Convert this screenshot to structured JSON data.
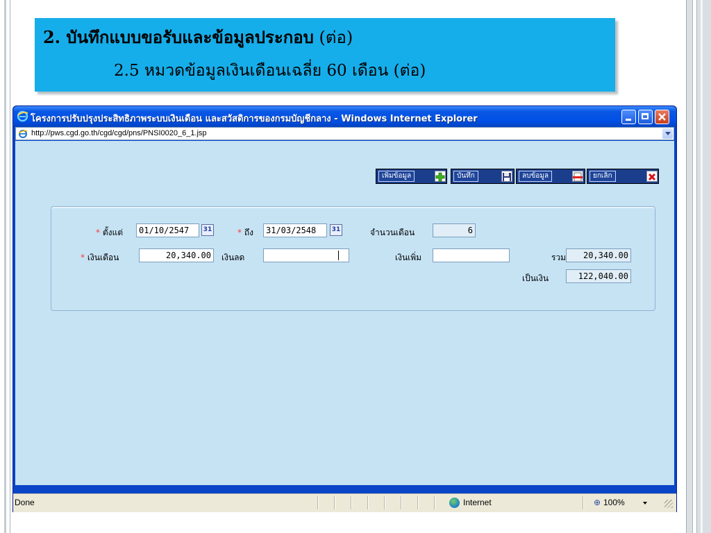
{
  "slide": {
    "title_bold": "2. บันทึกแบบขอรับและข้อมูลประกอบ",
    "title_suffix": " (ต่อ)",
    "subtitle": "2.5 หมวดข้อมูลเงินเดือนเฉลี่ย 60 เดือน (ต่อ)",
    "title_bg_color": "#16aeea"
  },
  "window": {
    "title": "โครงการปรับปรุงประสิทธิภาพระบบเงินเดือน และสวัสดิการของกรมบัญชีกลาง - Windows Internet Explorer",
    "address": "http://pws.cgd.go.th/cgd/cgd/pns/PNSI0020_6_1.jsp",
    "titlebar_color": "#0a57e3"
  },
  "toolbar": {
    "add_label": "เพิ่มข้อมูล",
    "save_label": "บันทึก",
    "delete_label": "ลบข้อมูล",
    "cancel_label": "ยกเลิก"
  },
  "form": {
    "required_mark": "*",
    "from_label": "ตั้งแต่",
    "from_value": "01/10/2547",
    "to_label": "ถึง",
    "to_value": "31/03/2548",
    "calendar_glyph": "31",
    "months_label": "จำนวนเดือน",
    "months_value": "6",
    "salary_label": "เงินเดือน",
    "salary_value": "20,340.00",
    "reduce_label": "เงินลด",
    "reduce_value": "",
    "increase_label": "เงินเพิ่ม",
    "increase_value": "",
    "total_label": "รวม",
    "total_value": "20,340.00",
    "amount_label": "เป็นเงิน",
    "amount_value": "122,040.00",
    "content_bg_color": "#c6e3f4"
  },
  "status": {
    "left_text": "Done",
    "zone": "Internet",
    "zoom": "100%"
  }
}
